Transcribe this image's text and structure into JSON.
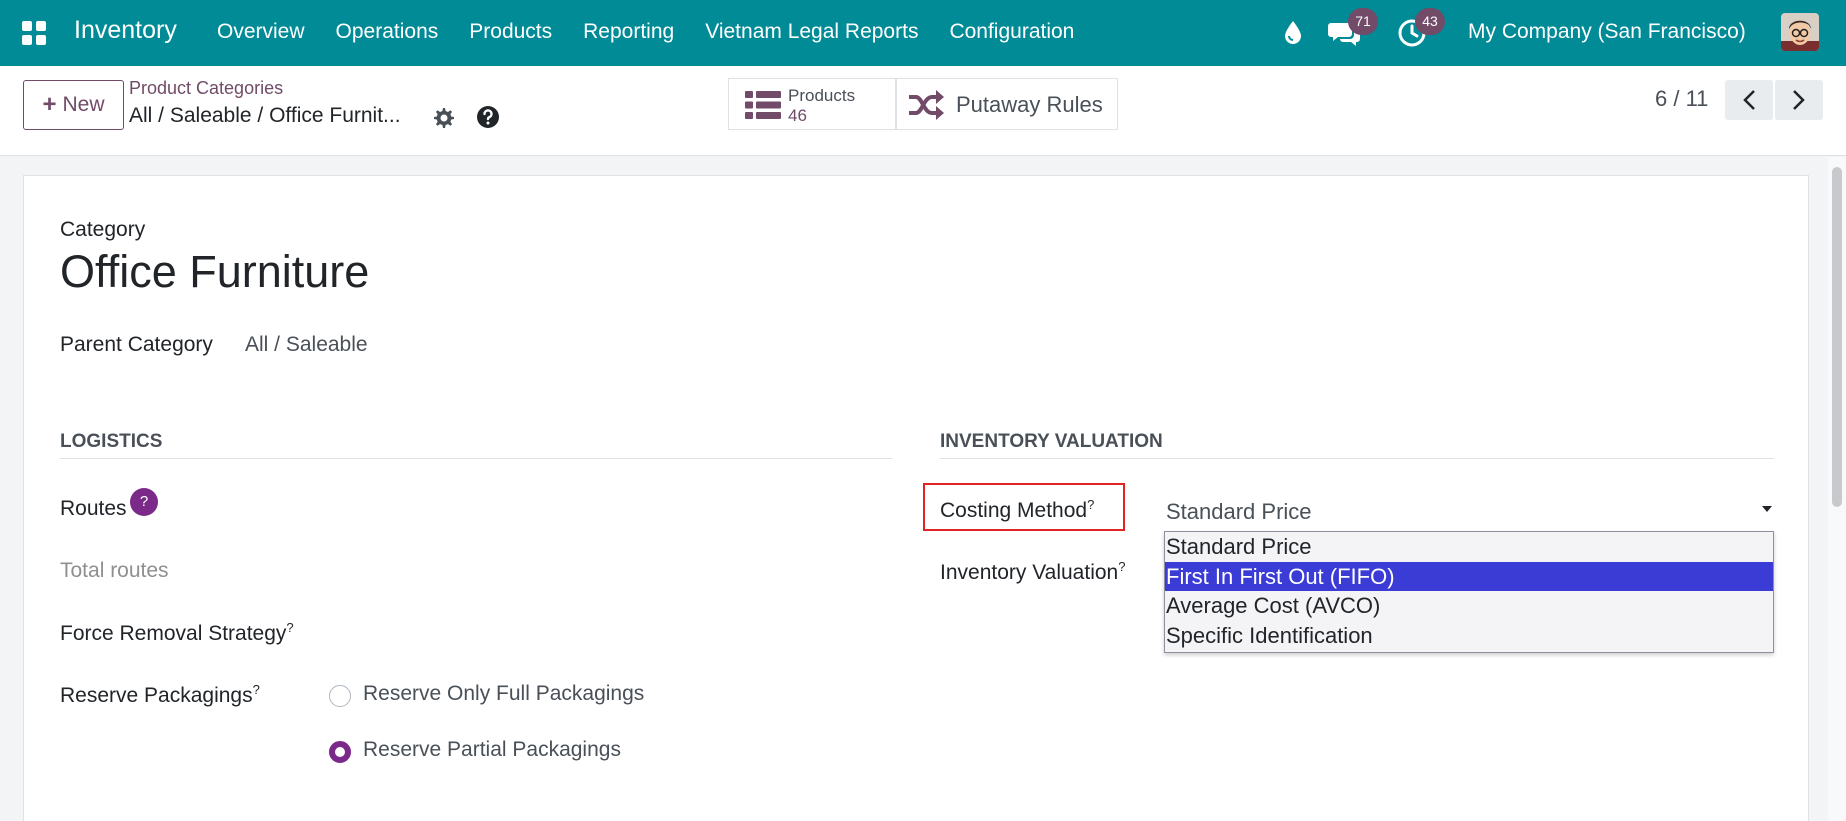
{
  "navbar": {
    "app_name": "Inventory",
    "menu": [
      "Overview",
      "Operations",
      "Products",
      "Reporting",
      "Vietnam Legal Reports",
      "Configuration"
    ],
    "messages_count": "71",
    "activities_count": "43",
    "company": "My Company (San Francisco)",
    "icons": [
      "apps-icon",
      "drop-icon",
      "chat-icon",
      "activity-clock-icon",
      "avatar"
    ],
    "colors": {
      "navbar": "#018b96",
      "accent": "#714b67",
      "badge": "#714b67"
    }
  },
  "control_panel": {
    "new_label": "New",
    "breadcrumb_parent": "Product Categories",
    "breadcrumb_current": "All / Saleable / Office Furnit...",
    "smart_products_label": "Products",
    "smart_products_value": "46",
    "smart_putaway_label": "Putaway Rules",
    "pager": "6 / 11"
  },
  "form": {
    "category_label": "Category",
    "title": "Office Furniture",
    "parent_label": "Parent Category",
    "parent_value": "All / Saleable",
    "logistics_title": "LOGISTICS",
    "valuation_title": "INVENTORY VALUATION",
    "routes_label": "Routes",
    "routes_help": "?",
    "total_routes": "Total routes",
    "force_removal_label": "Force Removal Strategy",
    "reserve_packagings_label": "Reserve Packagings",
    "reserve_options": [
      "Reserve Only Full Packagings",
      "Reserve Partial Packagings"
    ],
    "reserve_selected": "Reserve Partial Packagings",
    "costing_method_label": "Costing Method",
    "inventory_valuation_label": "Inventory Valuation",
    "costing_method_value": "Standard Price",
    "costing_options": [
      "Standard Price",
      "First In First Out (FIFO)",
      "Average Cost (AVCO)",
      "Specific Identification"
    ],
    "highlighted_option": "First In First Out (FIFO)",
    "tooltip_mark": "?"
  }
}
